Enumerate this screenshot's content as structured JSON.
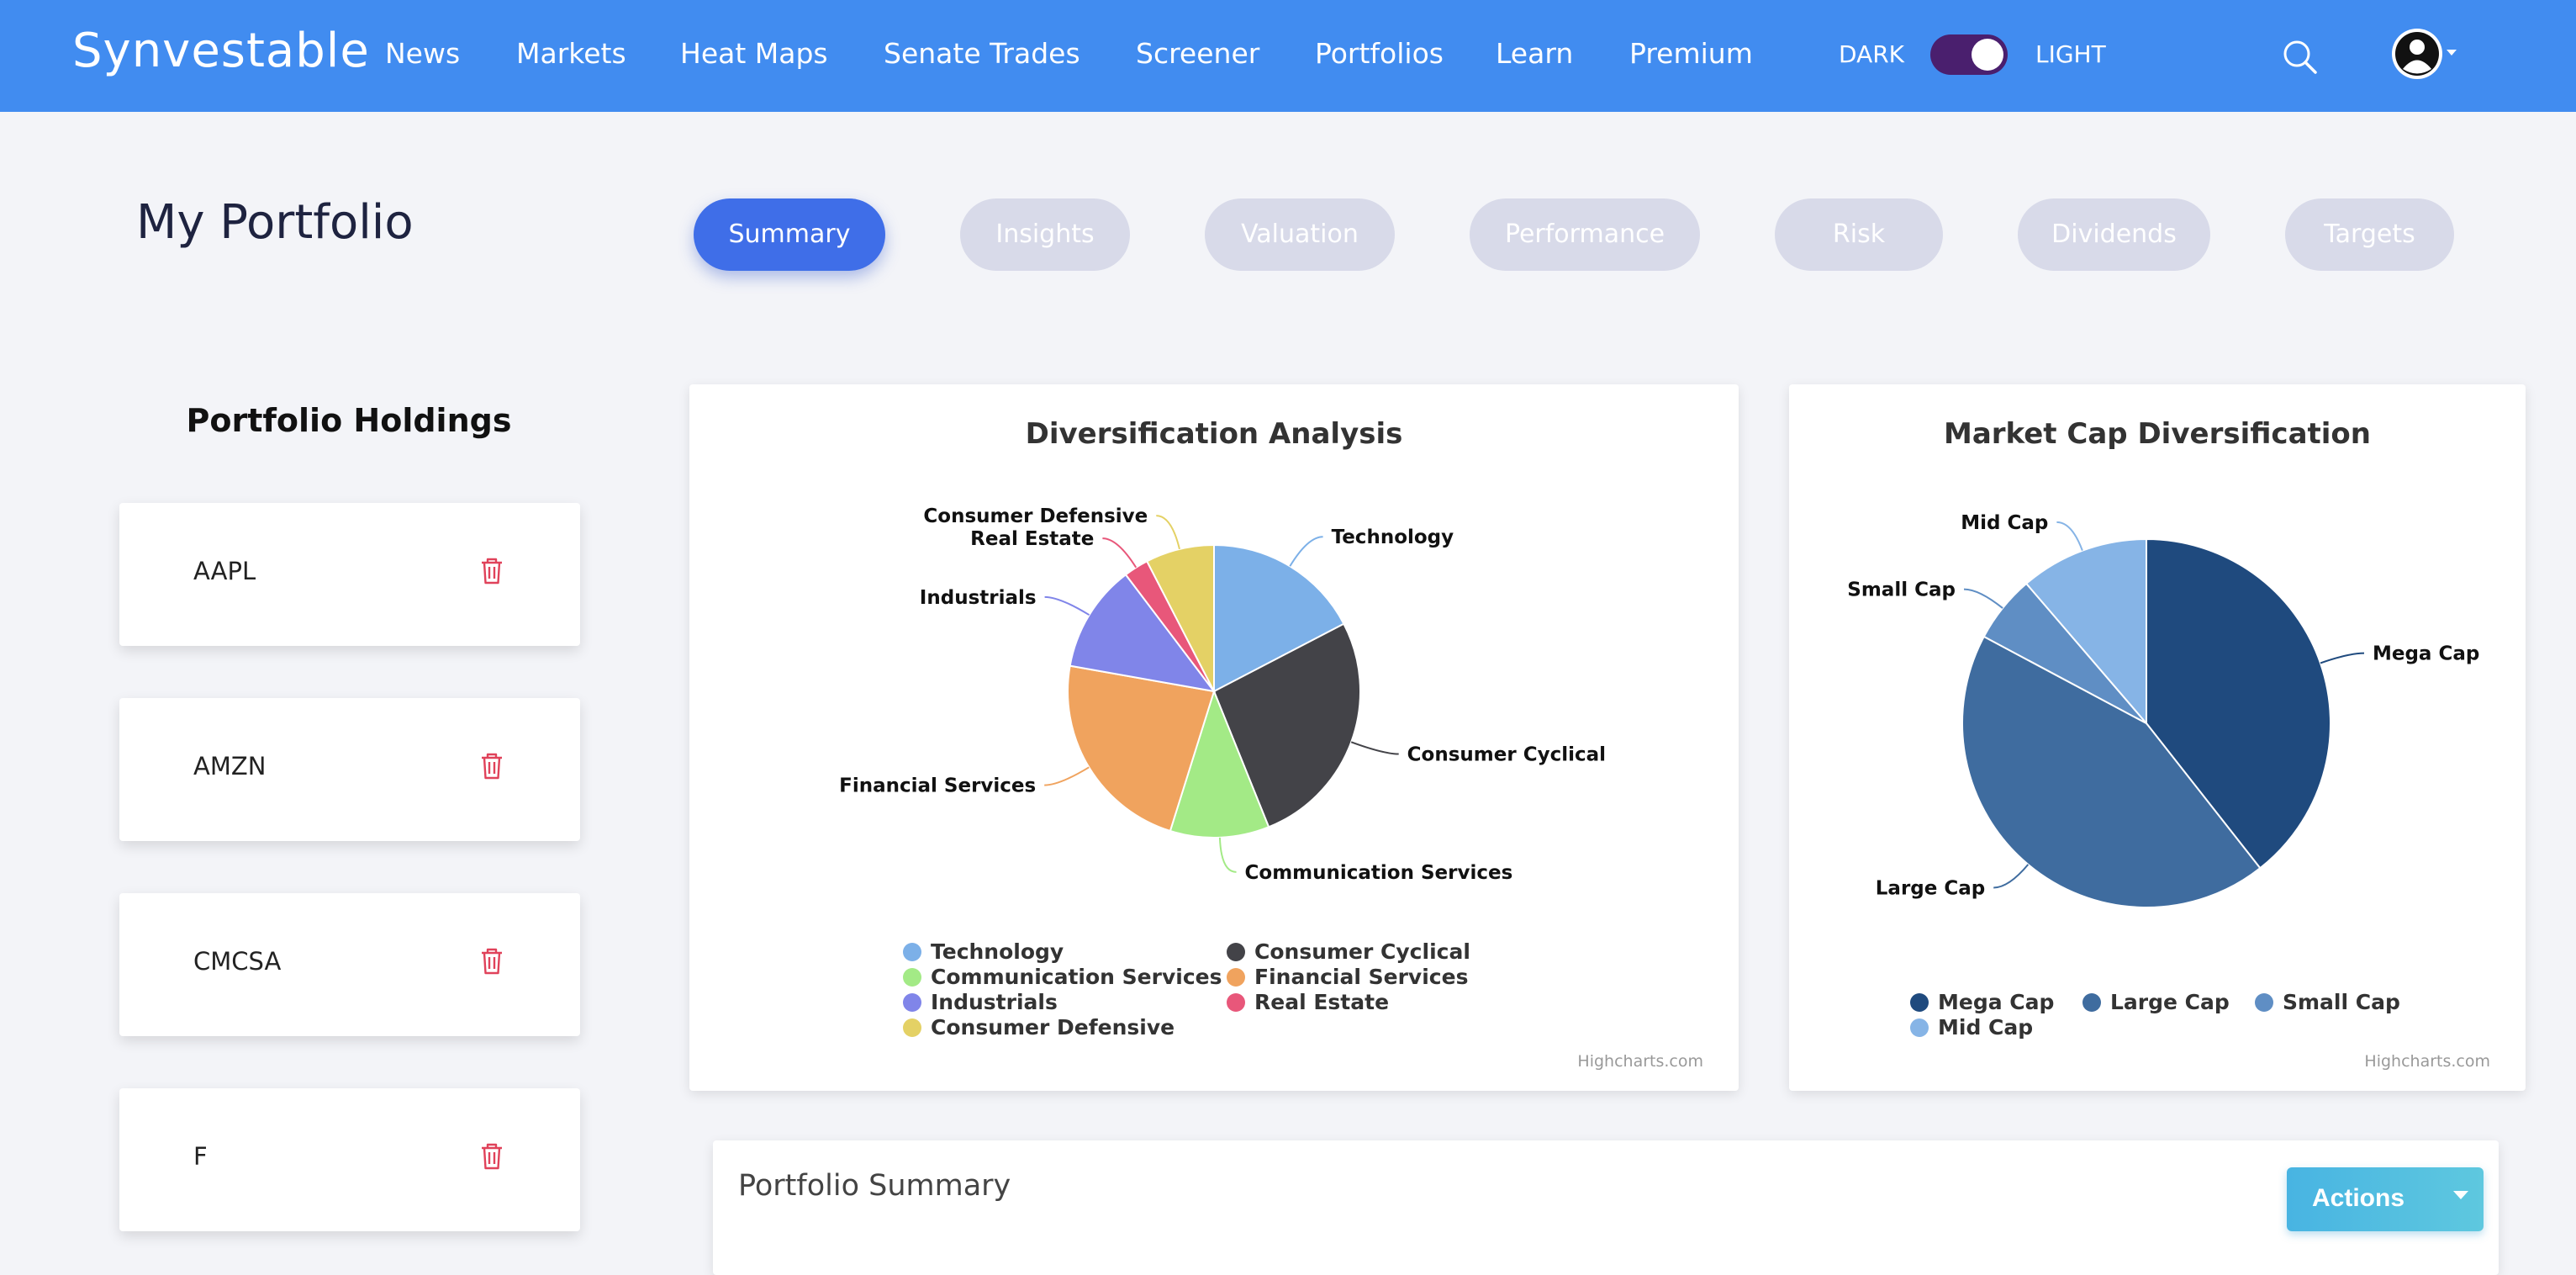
{
  "nav": {
    "brand": "Synvestable",
    "links": [
      "News",
      "Markets",
      "Heat Maps",
      "Senate Trades",
      "Screener",
      "Portfolios",
      "Learn",
      "Premium"
    ],
    "mode_dark": "DARK",
    "mode_light": "LIGHT"
  },
  "page": {
    "title": "My Portfolio",
    "tabs": [
      "Summary",
      "Insights",
      "Valuation",
      "Performance",
      "Risk",
      "Dividends",
      "Targets"
    ],
    "active_tab": "Summary"
  },
  "holdings": {
    "title": "Portfolio Holdings",
    "items": [
      "AAPL",
      "AMZN",
      "CMCSA",
      "F"
    ]
  },
  "summary": {
    "title": "Portfolio Summary",
    "actions_label": "Actions"
  },
  "colors": {
    "nav_bg": "#418cf0",
    "active_tab": "#3f6ee8",
    "trash": "#e0425a"
  },
  "chart_data": [
    {
      "type": "pie",
      "title": "Diversification Analysis",
      "credit": "Highcharts.com",
      "legend_position": "bottom",
      "slices": [
        {
          "label": "Technology",
          "value": 16.5,
          "color": "#7cb0e8"
        },
        {
          "label": "Consumer Cyclical",
          "value": 25.2,
          "color": "#434348"
        },
        {
          "label": "Communication Services",
          "value": 10.4,
          "color": "#a3ea86"
        },
        {
          "label": "Financial Services",
          "value": 21.8,
          "color": "#f0a35e"
        },
        {
          "label": "Industrials",
          "value": 11.3,
          "color": "#8085e9"
        },
        {
          "label": "Real Estate",
          "value": 2.6,
          "color": "#e8577a"
        },
        {
          "label": "Consumer Defensive",
          "value": 7.2,
          "color": "#e4d165"
        }
      ],
      "legend": [
        "Technology",
        "Consumer Cyclical",
        "Communication Services",
        "Financial Services",
        "Industrials",
        "Real Estate",
        "Consumer Defensive"
      ]
    },
    {
      "type": "pie",
      "title": "Market Cap Diversification",
      "credit": "Highcharts.com",
      "legend_position": "bottom",
      "slices": [
        {
          "label": "Mega Cap",
          "value": 39.4,
          "color": "#1f4a7e"
        },
        {
          "label": "Large Cap",
          "value": 43.4,
          "color": "#3f6c9f"
        },
        {
          "label": "Small Cap",
          "value": 5.9,
          "color": "#5f8ec4"
        },
        {
          "label": "Mid Cap",
          "value": 11.3,
          "color": "#86b4e6"
        }
      ],
      "legend": [
        "Mega Cap",
        "Large Cap",
        "Small Cap",
        "Mid Cap"
      ]
    }
  ]
}
